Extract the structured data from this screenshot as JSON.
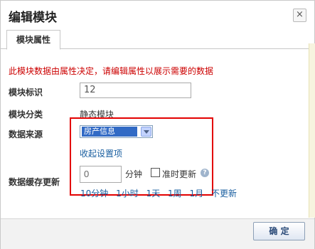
{
  "dialog": {
    "title": "编辑模块",
    "close_symbol": "×"
  },
  "tabs": [
    {
      "label": "模块属性"
    }
  ],
  "form": {
    "notice": "此模块数据由属性决定，请编辑属性以展示需要的数据",
    "module_id_label": "模块标识",
    "module_id_value": "12",
    "module_type_label": "模块分类",
    "module_type_value": "静态模块",
    "data_source_label": "数据来源",
    "data_source_selected": "房产信息",
    "collapse_link": "收起设置项",
    "cache_label": "数据缓存更新",
    "cache_value": "0",
    "cache_unit": "分钟",
    "on_time_update_label": "准时更新",
    "on_time_update_checked": false,
    "help_symbol": "?",
    "quick_options": [
      "10分钟",
      "1小时",
      "1天",
      "1周",
      "1月",
      "不更新"
    ]
  },
  "footer": {
    "ok_label": "确 定"
  },
  "colors": {
    "notice": "#cc0000",
    "link": "#1a5fa0",
    "highlight_box": "#e30000",
    "select_highlight": "#316ac5"
  },
  "icons": {
    "close": "close-icon",
    "help": "help-icon",
    "dropdown": "chevron-down-icon"
  }
}
